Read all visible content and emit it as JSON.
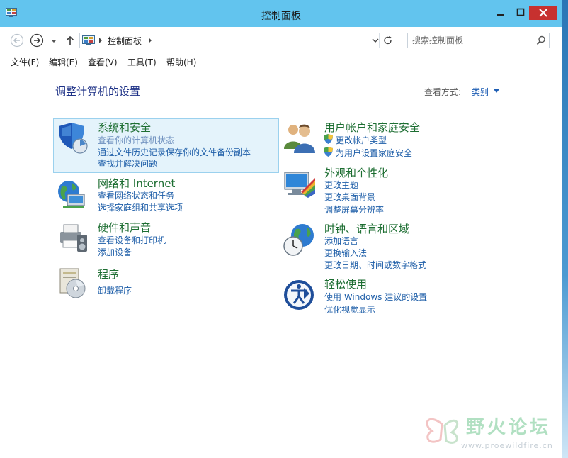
{
  "window": {
    "title": "控制面板"
  },
  "address": {
    "crumb": "控制面板"
  },
  "search": {
    "placeholder": "搜索控制面板"
  },
  "menu": [
    "文件(F)",
    "编辑(E)",
    "查看(V)",
    "工具(T)",
    "帮助(H)"
  ],
  "main": {
    "heading": "调整计算机的设置",
    "view_by_label": "查看方式:",
    "view_by_value": "类别"
  },
  "categories": [
    {
      "title": "系统和安全",
      "icon": "shield-icon",
      "links": [
        "查看你的计算机状态",
        "通过文件历史记录保存你的文件备份副本",
        "查找并解决问题"
      ]
    },
    {
      "title": "网络和 Internet",
      "icon": "network-globe-icon",
      "links": [
        "查看网络状态和任务",
        "选择家庭组和共享选项"
      ]
    },
    {
      "title": "硬件和声音",
      "icon": "printer-speaker-icon",
      "links": [
        "查看设备和打印机",
        "添加设备"
      ]
    },
    {
      "title": "程序",
      "icon": "programs-disc-icon",
      "links": [
        "卸载程序"
      ]
    },
    {
      "title": "用户帐户和家庭安全",
      "icon": "users-icon",
      "links": [
        "更改帐户类型",
        "为用户设置家庭安全"
      ]
    },
    {
      "title": "外观和个性化",
      "icon": "monitor-palette-icon",
      "links": [
        "更改主题",
        "更改桌面背景",
        "调整屏幕分辨率"
      ]
    },
    {
      "title": "时钟、语言和区域",
      "icon": "clock-globe-icon",
      "links": [
        "添加语言",
        "更换输入法",
        "更改日期、时间或数字格式"
      ]
    },
    {
      "title": "轻松使用",
      "icon": "ease-of-access-icon",
      "links": [
        "使用 Windows 建议的设置",
        "优化视觉显示"
      ]
    }
  ],
  "watermark": {
    "text": "野火论坛",
    "url": "www.proewildfire.cn"
  }
}
